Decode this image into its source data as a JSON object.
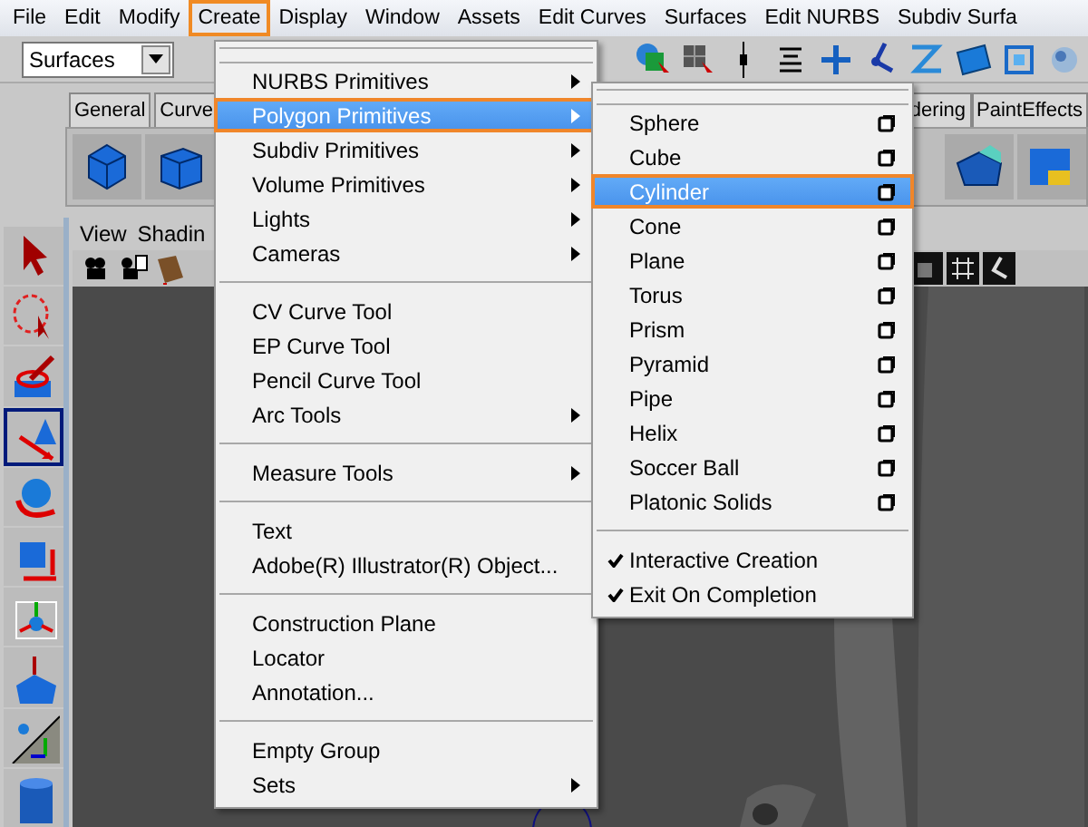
{
  "menubar": [
    {
      "label": "File",
      "selected": false
    },
    {
      "label": "Edit",
      "selected": false
    },
    {
      "label": "Modify",
      "selected": false
    },
    {
      "label": "Create",
      "selected": true
    },
    {
      "label": "Display",
      "selected": false
    },
    {
      "label": "Window",
      "selected": false
    },
    {
      "label": "Assets",
      "selected": false
    },
    {
      "label": "Edit Curves",
      "selected": false
    },
    {
      "label": "Surfaces",
      "selected": false
    },
    {
      "label": "Edit NURBS",
      "selected": false
    },
    {
      "label": "Subdiv Surfa",
      "selected": false
    }
  ],
  "status_line": {
    "menu_set": "Surfaces"
  },
  "shelf_tabs": [
    {
      "label": "General"
    },
    {
      "label": "Curve"
    },
    {
      "label": "dering"
    },
    {
      "label": "PaintEffects"
    }
  ],
  "toolbox": [
    {
      "selected": false
    },
    {
      "selected": false
    },
    {
      "selected": false
    },
    {
      "selected": true
    },
    {
      "selected": false
    },
    {
      "selected": false
    },
    {
      "selected": false
    },
    {
      "selected": false
    },
    {
      "selected": false
    },
    {
      "selected": false
    }
  ],
  "panel_menu": [
    "View",
    "Shadin"
  ],
  "create_menu": [
    [
      {
        "label": "NURBS Primitives",
        "submenu": true,
        "selected": false
      },
      {
        "label": "Polygon Primitives",
        "submenu": true,
        "selected": true
      },
      {
        "label": "Subdiv Primitives",
        "submenu": true,
        "selected": false
      },
      {
        "label": "Volume Primitives",
        "submenu": true,
        "selected": false
      },
      {
        "label": "Lights",
        "submenu": true,
        "selected": false
      },
      {
        "label": "Cameras",
        "submenu": true,
        "selected": false
      }
    ],
    [
      {
        "label": "CV Curve Tool",
        "submenu": false,
        "selected": false
      },
      {
        "label": "EP Curve Tool",
        "submenu": false,
        "selected": false
      },
      {
        "label": "Pencil Curve Tool",
        "submenu": false,
        "selected": false
      },
      {
        "label": "Arc Tools",
        "submenu": true,
        "selected": false
      }
    ],
    [
      {
        "label": "Measure Tools",
        "submenu": true,
        "selected": false
      }
    ],
    [
      {
        "label": "Text",
        "submenu": false,
        "selected": false
      },
      {
        "label": "Adobe(R) Illustrator(R) Object...",
        "submenu": false,
        "selected": false
      }
    ],
    [
      {
        "label": "Construction Plane",
        "submenu": false,
        "selected": false
      },
      {
        "label": "Locator",
        "submenu": false,
        "selected": false
      },
      {
        "label": "Annotation...",
        "submenu": false,
        "selected": false
      }
    ],
    [
      {
        "label": "Empty Group",
        "submenu": false,
        "selected": false
      },
      {
        "label": "Sets",
        "submenu": true,
        "selected": false
      }
    ]
  ],
  "polygon_primitives_menu": {
    "items": [
      {
        "label": "Sphere",
        "selected": false
      },
      {
        "label": "Cube",
        "selected": false
      },
      {
        "label": "Cylinder",
        "selected": true
      },
      {
        "label": "Cone",
        "selected": false
      },
      {
        "label": "Plane",
        "selected": false
      },
      {
        "label": "Torus",
        "selected": false
      },
      {
        "label": "Prism",
        "selected": false
      },
      {
        "label": "Pyramid",
        "selected": false
      },
      {
        "label": "Pipe",
        "selected": false
      },
      {
        "label": "Helix",
        "selected": false
      },
      {
        "label": "Soccer Ball",
        "selected": false
      },
      {
        "label": "Platonic Solids",
        "selected": false
      }
    ],
    "options": [
      {
        "label": "Interactive Creation",
        "checked": true
      },
      {
        "label": "Exit On Completion",
        "checked": true
      }
    ]
  }
}
